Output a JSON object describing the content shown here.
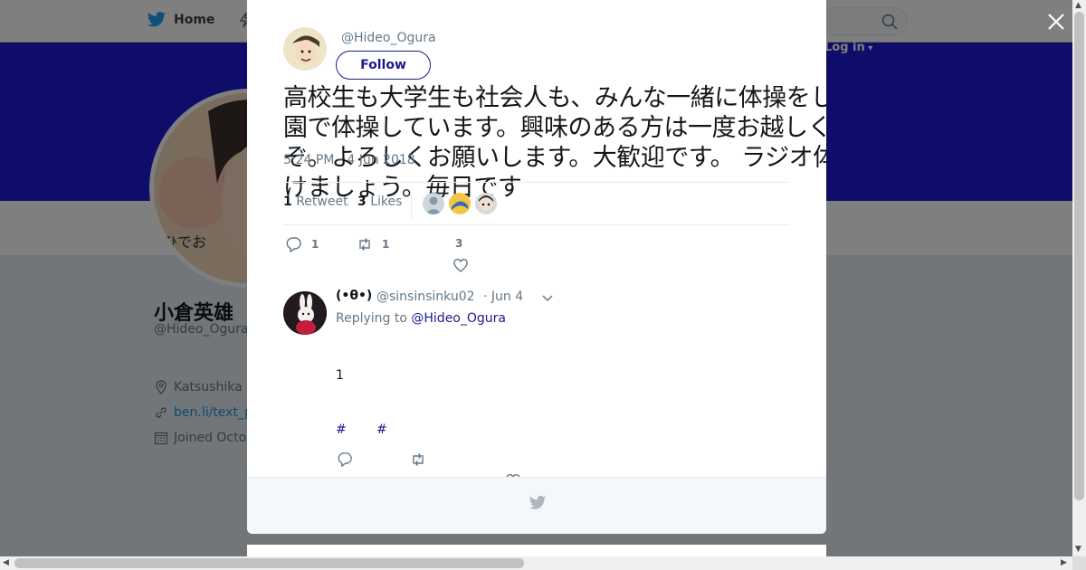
{
  "nav": {
    "home_label": "Home",
    "login_label": "Log in"
  },
  "profile": {
    "name": "小倉英雄",
    "handle": "@Hideo_Ogura",
    "location": "Katsushika",
    "link": "ben.li/text_p",
    "joined": "Joined Octo"
  },
  "tweet": {
    "author_handle": "@Hideo_Ogura",
    "follow_label": "Follow",
    "text": "高校生も大学生も社会人も、みんな一緒に体操をしよう。毎朝六時から公園で体操しています。興味のある方は一度お越しください。気軽にどうぞ。よろしくお願いします。大歓迎です。 ラジオ体操をみんなで楽しく続けましょう。毎日です",
    "timestamp": "5:24 PM - 4 Jun 2018",
    "retweet_count": "1",
    "retweet_label": "Retweet",
    "likes_count": "3",
    "likes_label": "Likes",
    "action_reply_count": "1",
    "action_retweet_count": "1",
    "action_like_count": "3"
  },
  "reply": {
    "name": "(•θ•)",
    "handle": "@sinsinsinku02",
    "date": "· Jun 4",
    "replying_prefix": "Replying to",
    "replying_to": "@Hideo_Ogura",
    "body": "1",
    "hashtags": [
      "#",
      "#"
    ]
  },
  "colors": {
    "banner": "#1c1ad2",
    "link": "#1c1a8a",
    "muted": "#657786"
  }
}
